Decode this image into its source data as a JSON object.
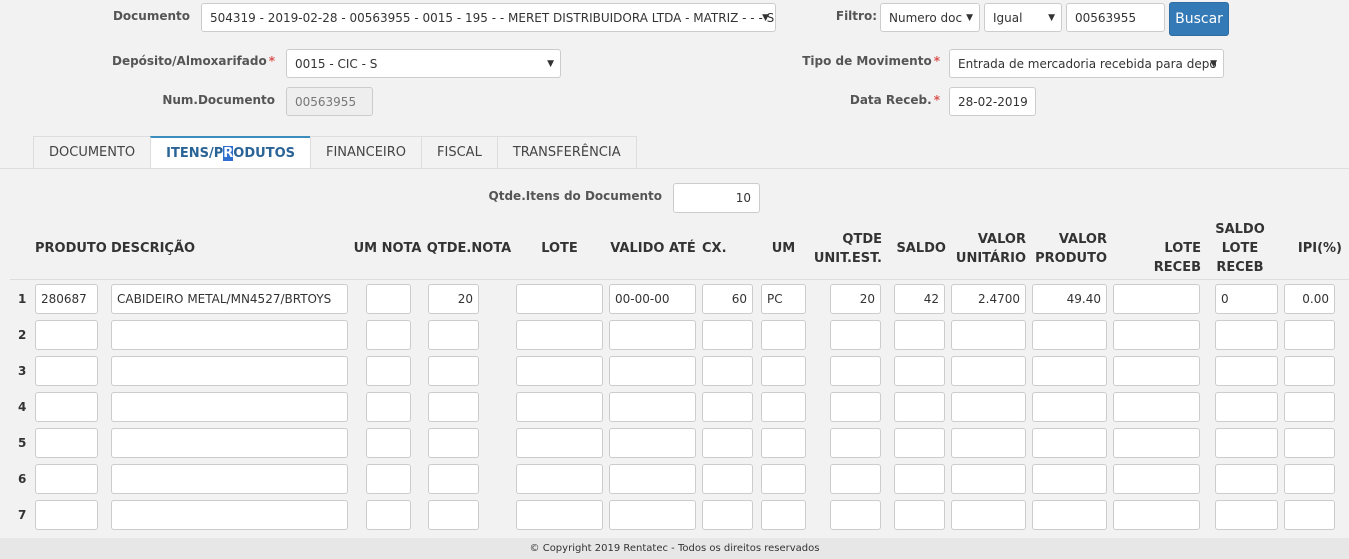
{
  "form": {
    "documento_label": "Documento",
    "documento_value": "504319 - 2019-02-28 - 00563955 - 0015 - 195 - - MERET DISTRIBUIDORA LTDA - MATRIZ - - - S",
    "filtro_label": "Filtro:",
    "filtro_field": "Numero doc",
    "filtro_op": "Igual",
    "filtro_value": "00563955",
    "buscar_label": "Buscar",
    "deposito_label": "Depósito/Almoxarifado",
    "deposito_value": "0015 - CIC - S",
    "tipo_label": "Tipo de Movimento",
    "tipo_value": "Entrada de mercadoria recebida para depo",
    "numdoc_label": "Num.Documento",
    "numdoc_value": "00563955",
    "datareceb_label": "Data Receb.",
    "datareceb_value": "28-02-2019",
    "required_mark": "*"
  },
  "tabs": [
    {
      "label": "DOCUMENTO"
    },
    {
      "label_pre": "ITENS/P",
      "label_hl": "R",
      "label_post": "ODUTOS",
      "active": true
    },
    {
      "label": "FINANCEIRO"
    },
    {
      "label": "FISCAL"
    },
    {
      "label": "TRANSFERÊNCIA"
    }
  ],
  "itens": {
    "qtde_label": "Qtde.Itens do Documento",
    "qtde_value": "10",
    "headers": {
      "produto": "PRODUTO",
      "descricao": "DESCRIÇÃO",
      "um_nota": "UM NOTA",
      "qtde_nota": "QTDE.NOTA",
      "lote": "LOTE",
      "valido_ate": "VALIDO ATÉ",
      "cx": "CX.",
      "um": "UM",
      "qtde_unit_1": "QTDE",
      "qtde_unit_2": "UNIT.EST.",
      "saldo": "SALDO",
      "valor_unit_1": "VALOR",
      "valor_unit_2": "UNITÁRIO",
      "valor_prod_1": "VALOR",
      "valor_prod_2": "PRODUTO",
      "lote_receb": "LOTE RECEB",
      "saldo_lote_1": "SALDO",
      "saldo_lote_2": "LOTE",
      "saldo_lote_3": "RECEB",
      "ipi": "IPI(%)"
    },
    "rows": [
      {
        "n": "1",
        "produto": "280687",
        "descricao": "CABIDEIRO METAL/MN4527/BRTOYS",
        "um_nota": "",
        "qtde_nota": "20",
        "lote": "",
        "valido_ate": "00-00-00",
        "cx": "60",
        "um": "PC",
        "qtde_unit": "20",
        "saldo": "42",
        "valor_unit": "2.4700",
        "valor_prod": "49.40",
        "lote_receb": "",
        "saldo_lote": "0",
        "ipi": "0.00"
      },
      {
        "n": "2",
        "produto": "",
        "descricao": "",
        "um_nota": "",
        "qtde_nota": "",
        "lote": "",
        "valido_ate": "",
        "cx": "",
        "um": "",
        "qtde_unit": "",
        "saldo": "",
        "valor_unit": "",
        "valor_prod": "",
        "lote_receb": "",
        "saldo_lote": "",
        "ipi": ""
      },
      {
        "n": "3",
        "produto": "",
        "descricao": "",
        "um_nota": "",
        "qtde_nota": "",
        "lote": "",
        "valido_ate": "",
        "cx": "",
        "um": "",
        "qtde_unit": "",
        "saldo": "",
        "valor_unit": "",
        "valor_prod": "",
        "lote_receb": "",
        "saldo_lote": "",
        "ipi": ""
      },
      {
        "n": "4",
        "produto": "",
        "descricao": "",
        "um_nota": "",
        "qtde_nota": "",
        "lote": "",
        "valido_ate": "",
        "cx": "",
        "um": "",
        "qtde_unit": "",
        "saldo": "",
        "valor_unit": "",
        "valor_prod": "",
        "lote_receb": "",
        "saldo_lote": "",
        "ipi": ""
      },
      {
        "n": "5",
        "produto": "",
        "descricao": "",
        "um_nota": "",
        "qtde_nota": "",
        "lote": "",
        "valido_ate": "",
        "cx": "",
        "um": "",
        "qtde_unit": "",
        "saldo": "",
        "valor_unit": "",
        "valor_prod": "",
        "lote_receb": "",
        "saldo_lote": "",
        "ipi": ""
      },
      {
        "n": "6",
        "produto": "",
        "descricao": "",
        "um_nota": "",
        "qtde_nota": "",
        "lote": "",
        "valido_ate": "",
        "cx": "",
        "um": "",
        "qtde_unit": "",
        "saldo": "",
        "valor_unit": "",
        "valor_prod": "",
        "lote_receb": "",
        "saldo_lote": "",
        "ipi": ""
      },
      {
        "n": "7",
        "produto": "",
        "descricao": "",
        "um_nota": "",
        "qtde_nota": "",
        "lote": "",
        "valido_ate": "",
        "cx": "",
        "um": "",
        "qtde_unit": "",
        "saldo": "",
        "valor_unit": "",
        "valor_prod": "",
        "lote_receb": "",
        "saldo_lote": "",
        "ipi": ""
      }
    ]
  },
  "footer": {
    "text": "© Copyright 2019 Rentatec - Todos os direitos reservados"
  },
  "colors": {
    "accent": "#337ab7",
    "required": "#d9534f",
    "tab_active": "#2a6496"
  }
}
